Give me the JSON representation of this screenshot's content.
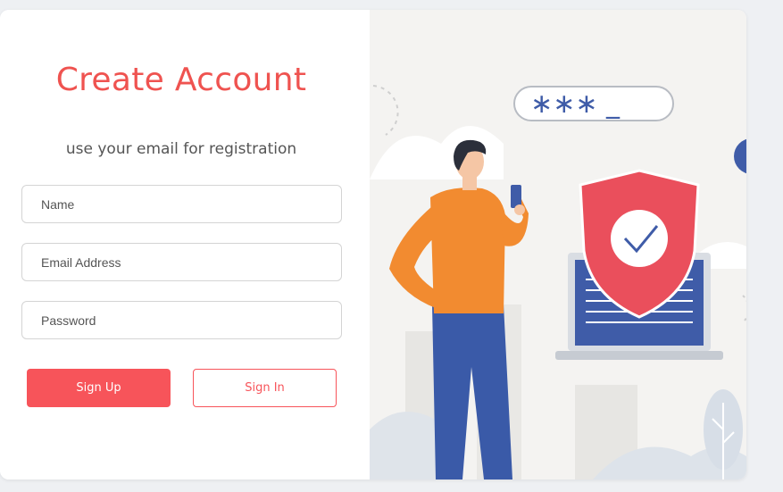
{
  "form": {
    "title": "Create Account",
    "subtitle": "use your email for registration",
    "fields": {
      "name": {
        "placeholder": "Name",
        "value": ""
      },
      "email": {
        "placeholder": "Email Address",
        "value": ""
      },
      "password": {
        "placeholder": "Password",
        "value": ""
      }
    },
    "buttons": {
      "sign_up": "Sign Up",
      "sign_in": "Sign In"
    }
  },
  "illustration": {
    "password_mask": "∗∗∗ _",
    "icons": [
      "person-holding-phone",
      "shield-check-icon",
      "laptop-icon",
      "password-field-graphic"
    ]
  },
  "colors": {
    "accent": "#f7545a",
    "title": "#ef5350",
    "shirt": "#f28b30",
    "pants": "#3a5aa8",
    "laptop_screen": "#3f5ca8",
    "shield": "#ea4f5c"
  }
}
